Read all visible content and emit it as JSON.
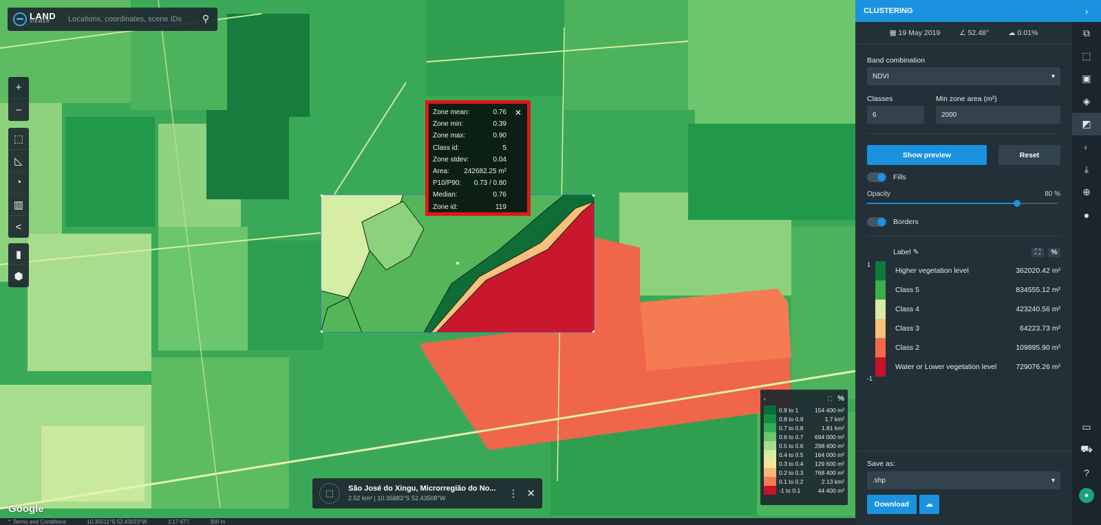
{
  "search": {
    "logo_top": "LAND",
    "logo_bottom": "VIEWER",
    "placeholder": "Locations, coordinates, scene IDs"
  },
  "left_tools": {
    "zoom": [
      {
        "icon": "plus-icon",
        "glyph": "+"
      },
      {
        "icon": "minus-icon",
        "glyph": "−"
      }
    ],
    "aoi": [
      {
        "icon": "aoi-draw-icon",
        "glyph": "⬚"
      },
      {
        "icon": "ruler-icon",
        "glyph": "◺"
      },
      {
        "icon": "time-lapse-icon",
        "glyph": "◔"
      },
      {
        "icon": "book-icon",
        "glyph": "▥"
      },
      {
        "icon": "share-icon",
        "glyph": "<"
      }
    ],
    "analytics": [
      {
        "icon": "bar-chart-icon",
        "glyph": "▮"
      },
      {
        "icon": "cube-icon",
        "glyph": "⬢"
      }
    ]
  },
  "zone_popup": {
    "rows": [
      {
        "label": "Zone mean:",
        "value": "0.76"
      },
      {
        "label": "Zone min:",
        "value": "0.39"
      },
      {
        "label": "Zone max:",
        "value": "0.90"
      },
      {
        "label": "Class id:",
        "value": "5"
      },
      {
        "label": "Zone stdev:",
        "value": "0.04"
      },
      {
        "label": "Area:",
        "value": "242682.25 m²"
      },
      {
        "label": "P10/P90:",
        "value": "0.73 / 0.80"
      },
      {
        "label": "Median:",
        "value": "0.76"
      },
      {
        "label": "Zone id:",
        "value": "119"
      }
    ]
  },
  "location_card": {
    "title": "São José do Xingu, Microrregião do No...",
    "subtitle": "2.52 km² | 10.35883°S 52.43508°W"
  },
  "legend": {
    "pct": "%",
    "rows": [
      {
        "range": "0.9 to 1",
        "value": "154 400 m²",
        "color": "#0a6d3a"
      },
      {
        "range": "0.8 to 0.9",
        "value": "1.7 km²",
        "color": "#138f45"
      },
      {
        "range": "0.7 to 0.8",
        "value": "1.81 km²",
        "color": "#31ad58"
      },
      {
        "range": "0.6 to 0.7",
        "value": "694 000 m²",
        "color": "#6cc66e"
      },
      {
        "range": "0.5 to 0.6",
        "value": "298 400 m²",
        "color": "#a6dc8c"
      },
      {
        "range": "0.4 to 0.5",
        "value": "164 000 m²",
        "color": "#d5eea3"
      },
      {
        "range": "0.3 to 0.4",
        "value": "129 600 m²",
        "color": "#f6e39c"
      },
      {
        "range": "0.2 to 0.3",
        "value": "768 400 m²",
        "color": "#f9b775"
      },
      {
        "range": "0.1 to 0.2",
        "value": "2.13 km²",
        "color": "#f47b52"
      },
      {
        "range": "-1 to 0.1",
        "value": "44 400 m²",
        "color": "#c8112a"
      }
    ]
  },
  "bottom_bar": {
    "terms": "Terms and Conditions",
    "coords": "10.35511°S 52.43023°W",
    "scale": "1:17 677",
    "scalebar": "300 m"
  },
  "google": "Google",
  "right_panel": {
    "title": "CLUSTERING",
    "date": "19 May 2019",
    "angle": "52.48°",
    "cloud": "0.01%",
    "band_label": "Band combination",
    "band_value": "NDVI",
    "classes_label": "Classes",
    "classes_value": "6",
    "minzone_label": "Min zone area (m²)",
    "minzone_value": "2000",
    "preview_btn": "Show preview",
    "reset_btn": "Reset",
    "fills_label": "Fills",
    "opacity_label": "Opacity",
    "opacity_value": "80 %",
    "opacity_level": 0.8,
    "borders_label": "Borders",
    "label_header": "Label",
    "pct": "%",
    "scale_top": "1",
    "scale_bottom": "-1",
    "classes": [
      {
        "name": "Higher vegetation level",
        "area": "362020.42 m²",
        "color": "#0f7a3a"
      },
      {
        "name": "Class 5",
        "area": "834555.12 m²",
        "color": "#3bae4d"
      },
      {
        "name": "Class 4",
        "area": "423240.56 m²",
        "color": "#d5eea3"
      },
      {
        "name": "Class 3",
        "area": "64223.73 m²",
        "color": "#f8c07a"
      },
      {
        "name": "Class 2",
        "area": "109895.90 m²",
        "color": "#f26a45"
      },
      {
        "name": "Water or Lower vegetation level",
        "area": "729076.26 m²",
        "color": "#c8112a"
      }
    ],
    "save_label": "Save as:",
    "save_value": ".shp",
    "download_btn": "Download"
  },
  "rail": [
    "sentinel-icon",
    "aoi-icon",
    "image-icon",
    "layers-icon",
    "analytics-icon",
    "contrast-icon",
    "download-icon",
    "globe-icon",
    "info-icon"
  ],
  "rail_bottom": [
    "chat-icon",
    "cart-icon",
    "help-icon",
    "user-icon"
  ]
}
